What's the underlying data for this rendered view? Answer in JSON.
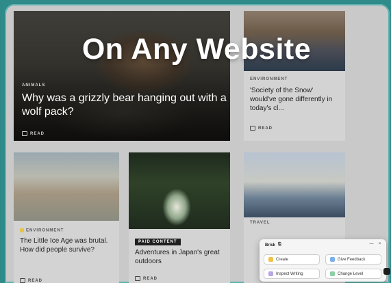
{
  "overlay": {
    "headline": "On Any Website"
  },
  "hero": {
    "tag": "ANIMALS",
    "title": "Why was a grizzly bear hanging out with a wolf pack?",
    "read": "READ"
  },
  "right_top": {
    "tag": "ENVIRONMENT",
    "title": "'Society of the Snow' would've gone differently in today's cl...",
    "read": "READ"
  },
  "cards": [
    {
      "tag": "ENVIRONMENT",
      "title": "The Little Ice Age was brutal. How did people survive?",
      "read": "READ"
    },
    {
      "badge": "PAID CONTENT",
      "title": "Adventures in Japan's great outdoors",
      "read": "READ"
    },
    {
      "tag": "TRAVEL",
      "title": "",
      "read": ""
    }
  ],
  "panel": {
    "title": "Brisk",
    "buttons": [
      "Create",
      "Give Feedback",
      "Inspect Writing",
      "Change Level"
    ]
  }
}
